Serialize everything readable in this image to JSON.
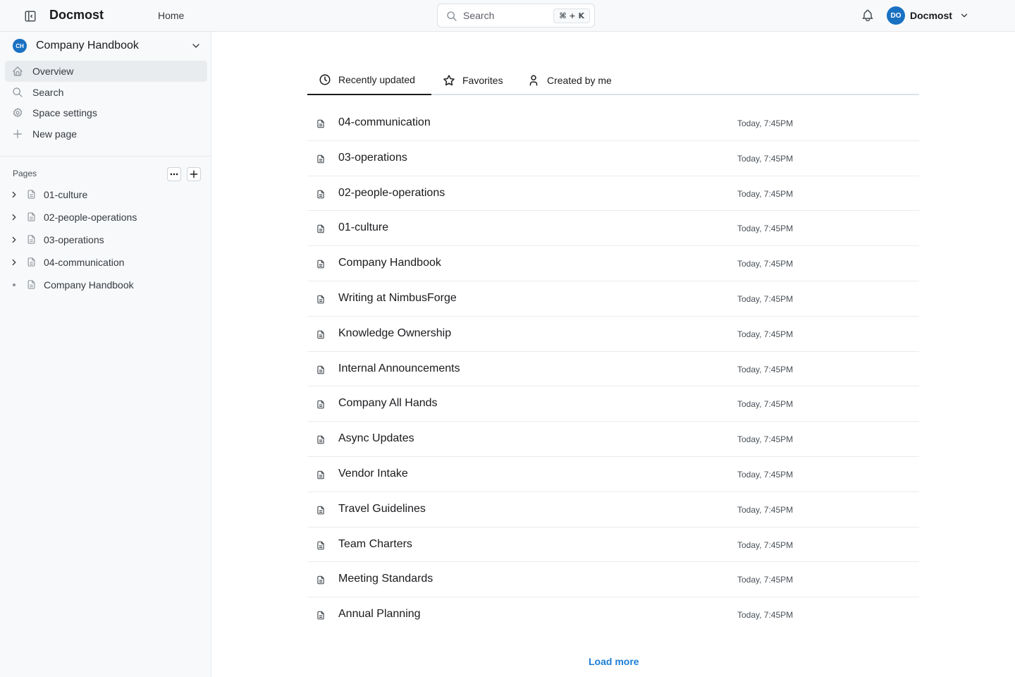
{
  "header": {
    "brand": "Docmost",
    "home_label": "Home",
    "search_placeholder": "Search",
    "search_shortcut": "⌘ + K",
    "user_initials": "DO",
    "user_name": "Docmost"
  },
  "sidebar": {
    "space_initials": "CH",
    "space_name": "Company Handbook",
    "nav": [
      {
        "label": "Overview",
        "icon": "home-icon",
        "active": true
      },
      {
        "label": "Search",
        "icon": "search-icon",
        "active": false
      },
      {
        "label": "Space settings",
        "icon": "gear-icon",
        "active": false
      },
      {
        "label": "New page",
        "icon": "plus-icon",
        "active": false
      }
    ],
    "pages_title": "Pages",
    "tree": [
      {
        "label": "01-culture",
        "expandable": true
      },
      {
        "label": "02-people-operations",
        "expandable": true
      },
      {
        "label": "03-operations",
        "expandable": true
      },
      {
        "label": "04-communication",
        "expandable": true
      },
      {
        "label": "Company Handbook",
        "expandable": false
      }
    ]
  },
  "main": {
    "tabs": [
      {
        "label": "Recently updated",
        "icon": "clock-icon",
        "active": true
      },
      {
        "label": "Favorites",
        "icon": "star-icon",
        "active": false
      },
      {
        "label": "Created by me",
        "icon": "user-icon",
        "active": false
      }
    ],
    "pages": [
      {
        "title": "04-communication",
        "updated": "Today, 7:45PM"
      },
      {
        "title": "03-operations",
        "updated": "Today, 7:45PM"
      },
      {
        "title": "02-people-operations",
        "updated": "Today, 7:45PM"
      },
      {
        "title": "01-culture",
        "updated": "Today, 7:45PM"
      },
      {
        "title": "Company Handbook",
        "updated": "Today, 7:45PM"
      },
      {
        "title": "Writing at NimbusForge",
        "updated": "Today, 7:45PM"
      },
      {
        "title": "Knowledge Ownership",
        "updated": "Today, 7:45PM"
      },
      {
        "title": "Internal Announcements",
        "updated": "Today, 7:45PM"
      },
      {
        "title": "Company All Hands",
        "updated": "Today, 7:45PM"
      },
      {
        "title": "Async Updates",
        "updated": "Today, 7:45PM"
      },
      {
        "title": "Vendor Intake",
        "updated": "Today, 7:45PM"
      },
      {
        "title": "Travel Guidelines",
        "updated": "Today, 7:45PM"
      },
      {
        "title": "Team Charters",
        "updated": "Today, 7:45PM"
      },
      {
        "title": "Meeting Standards",
        "updated": "Today, 7:45PM"
      },
      {
        "title": "Annual Planning",
        "updated": "Today, 7:45PM"
      }
    ],
    "load_more_label": "Load more"
  },
  "colors": {
    "accent": "#1971c2",
    "link": "#1c7ed6",
    "sidebar_bg": "#f8f9fa"
  }
}
